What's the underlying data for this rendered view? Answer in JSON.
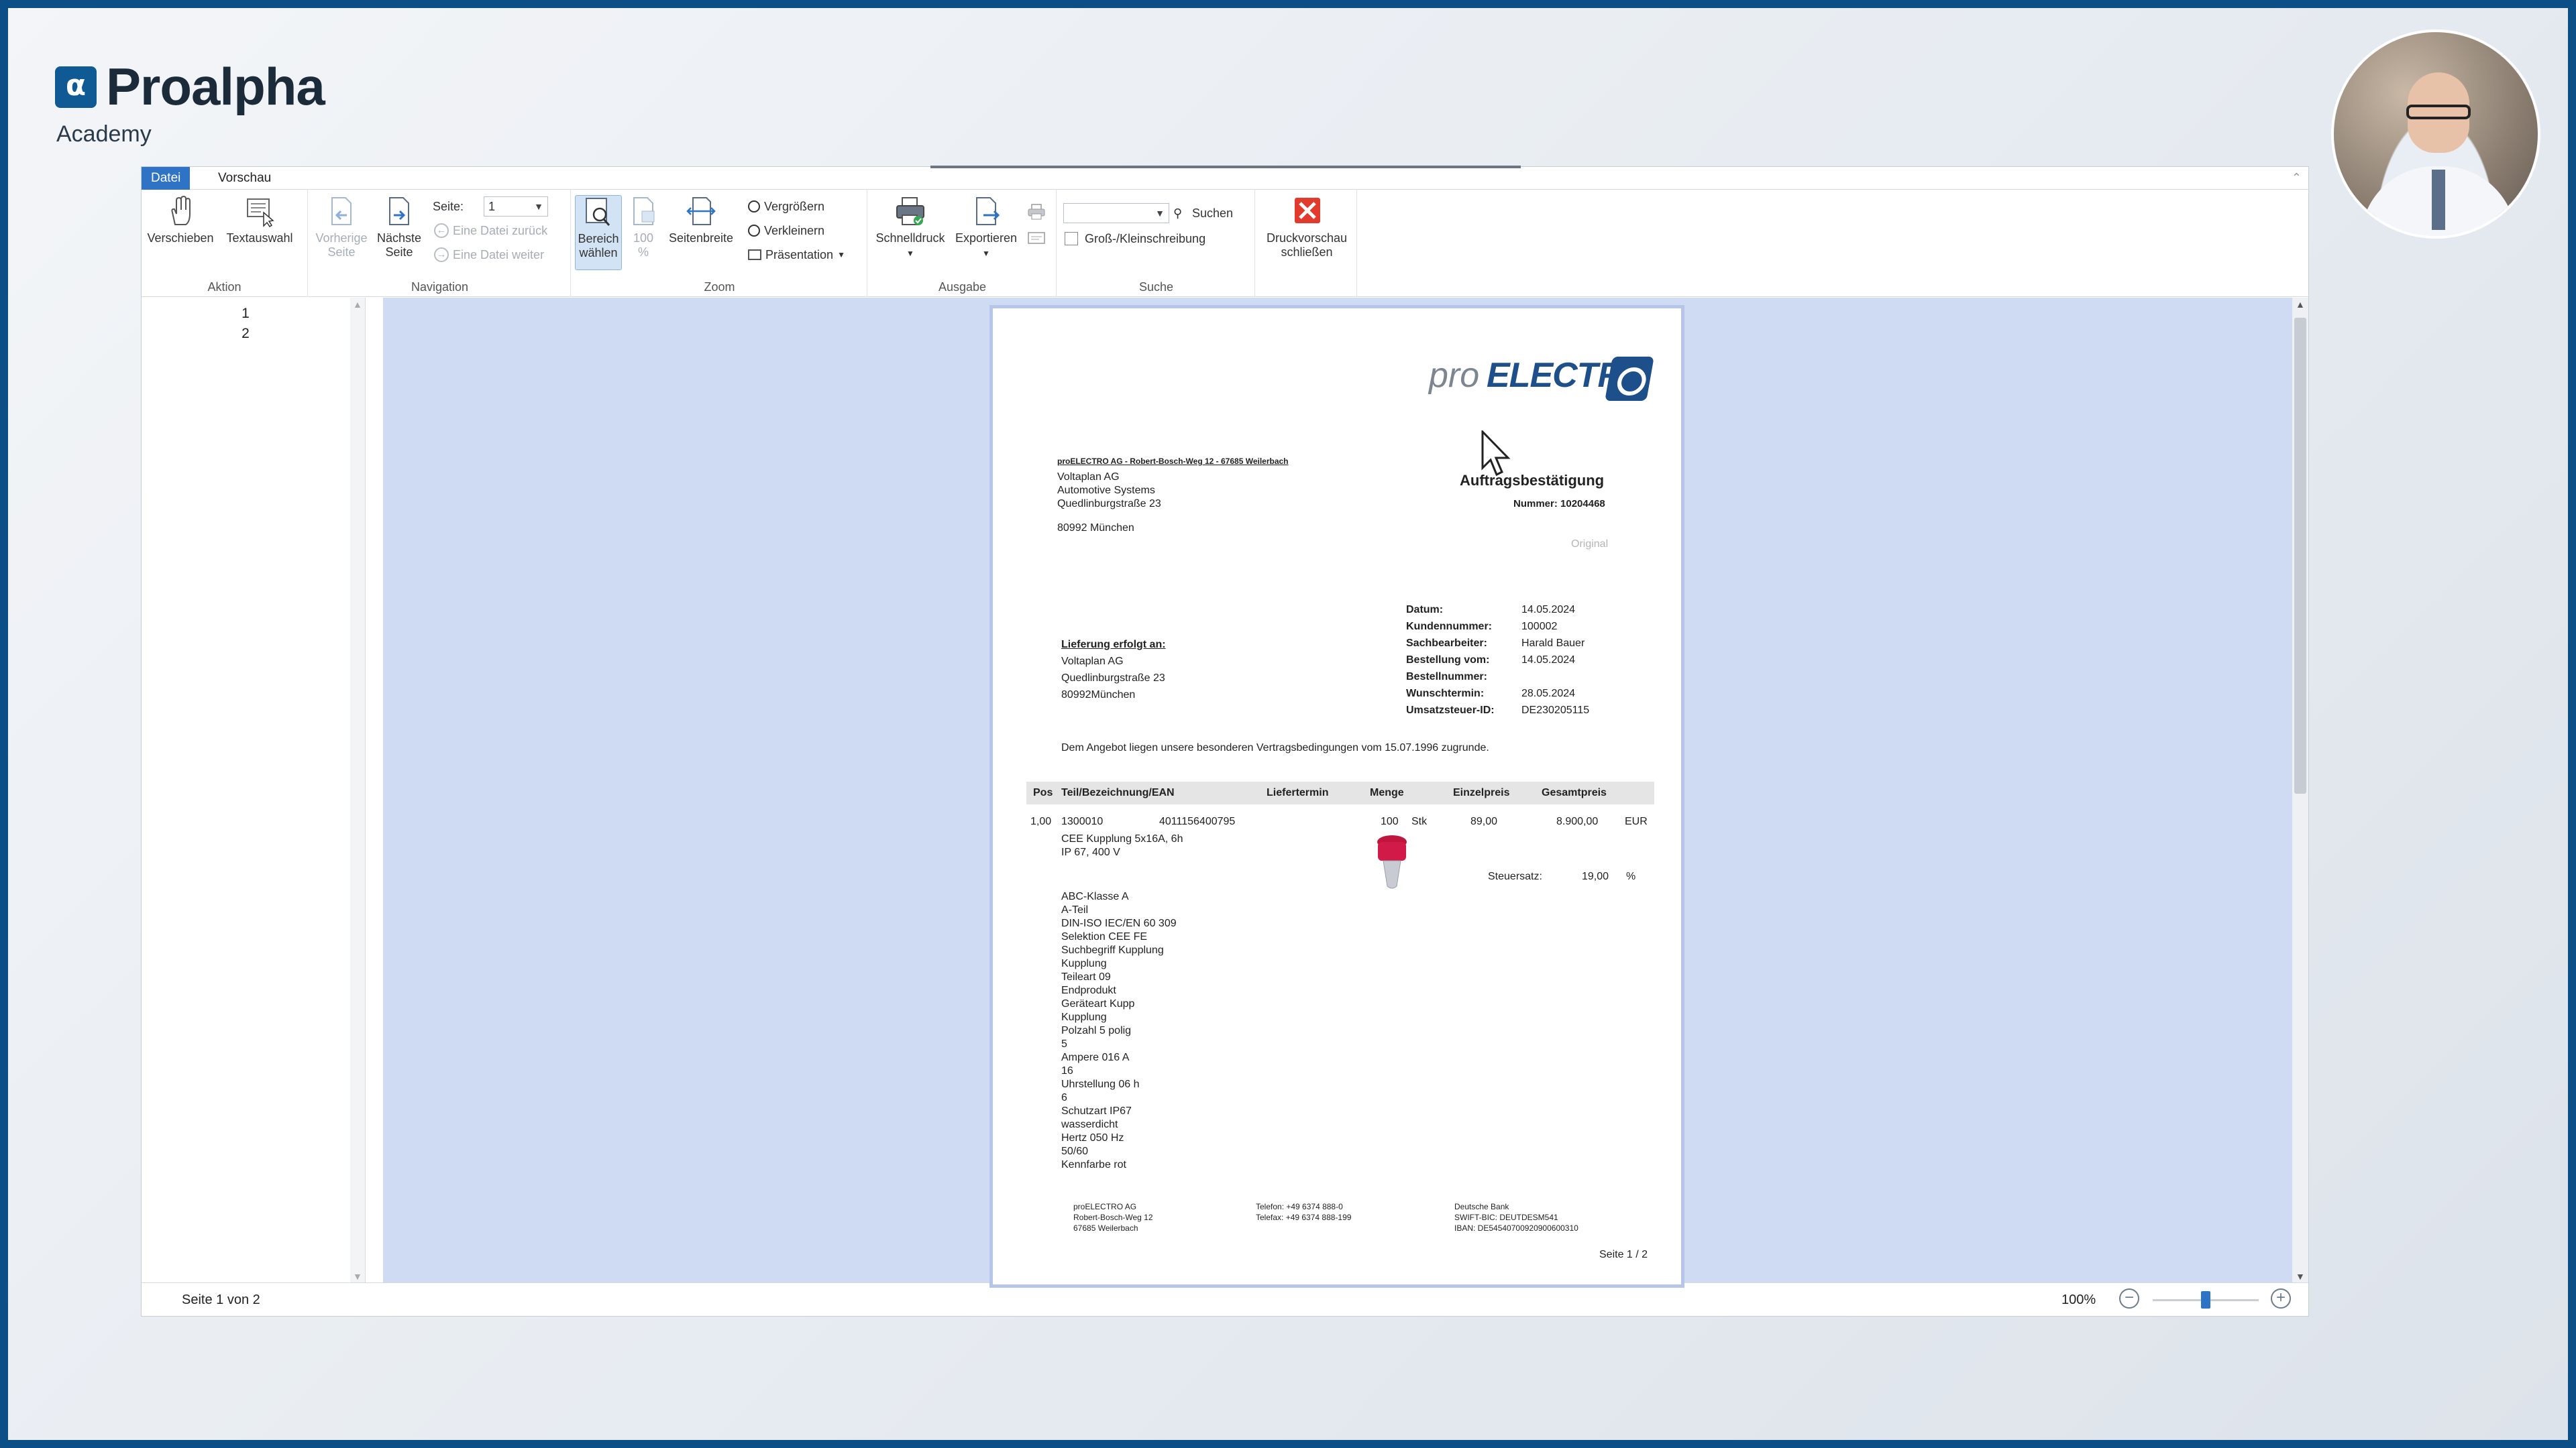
{
  "brand": {
    "name": "Proalpha",
    "sub": "Academy",
    "mark": "α"
  },
  "tabs": [
    {
      "label": "Datei",
      "active": true
    },
    {
      "label": "Vorschau",
      "active": false
    }
  ],
  "ribbon": {
    "aktion": {
      "label": "Aktion",
      "verschieben": "Verschieben",
      "textauswahl": "Textauswahl"
    },
    "navigation": {
      "label": "Navigation",
      "vorherige_1": "Vorherige",
      "vorherige_2": "Seite",
      "naechste_1": "Nächste",
      "naechste_2": "Seite",
      "seite_label": "Seite:",
      "seite_value": "1",
      "datei_zurueck": "Eine Datei zurück",
      "datei_weiter": "Eine Datei weiter"
    },
    "zoom": {
      "label": "Zoom",
      "bereich_1": "Bereich",
      "bereich_2": "wählen",
      "hundert_1": "100",
      "hundert_2": "%",
      "seitenbreite": "Seitenbreite",
      "vergroessern": "Vergrößern",
      "verkleinern": "Verkleinern",
      "praesentation": "Präsentation"
    },
    "ausgabe": {
      "label": "Ausgabe",
      "schnelldruck": "Schnelldruck",
      "exportieren": "Exportieren"
    },
    "suche": {
      "label": "Suche",
      "suchen": "Suchen",
      "grossklein": "Groß-/Kleinschreibung"
    },
    "schliessen": {
      "line1": "Druckvorschau",
      "line2": "schließen"
    }
  },
  "thumbs": [
    "1",
    "2"
  ],
  "status": {
    "page": "Seite 1 von 2",
    "zoom": "100%",
    "zoom_fraction": 0.5
  },
  "doc": {
    "logo_pro": "pro",
    "logo_elec": "ELECTR",
    "sender_line": "proELECTRO AG - Robert-Bosch-Weg 12 - 67685 Weilerbach",
    "recipient": [
      "Voltaplan AG",
      "Automotive Systems",
      "Quedlinburgstraße 23",
      "",
      "80992 München"
    ],
    "title": "Auftragsbestätigung",
    "nummer": "Nummer: 10204468",
    "original": "Original",
    "meta": [
      {
        "k": "Datum:",
        "v": "14.05.2024"
      },
      {
        "k": "Kundennummer:",
        "v": "100002"
      },
      {
        "k": "Sachbearbeiter:",
        "v": "Harald Bauer"
      },
      {
        "k": "Bestellung vom:",
        "v": "14.05.2024"
      },
      {
        "k": "Bestellnummer:",
        "v": ""
      },
      {
        "k": "Wunschtermin:",
        "v": "28.05.2024"
      },
      {
        "k": "Umsatzsteuer-ID:",
        "v": "DE230205115"
      }
    ],
    "delivery_heading": "Lieferung erfolgt an:",
    "delivery": [
      "Voltaplan AG",
      "Quedlinburgstraße 23",
      "80992München"
    ],
    "agreement": "Dem Angebot liegen unsere besonderen Vertragsbedingungen vom 15.07.1996 zugrunde.",
    "columns": {
      "pos": "Pos",
      "teil": "Teil/Bezeichnung/EAN",
      "liefer": "Liefertermin",
      "menge": "Menge",
      "einzel": "Einzelpreis",
      "gesamt": "Gesamtpreis"
    },
    "row": {
      "pos": "1,00",
      "teil": "1300010",
      "ean": "4011156400795",
      "menge": "100",
      "unit": "Stk",
      "einzel": "89,00",
      "gesamt": "8.900,00",
      "currency": "EUR",
      "desc1": "CEE Kupplung 5x16A, 6h",
      "desc2": "IP 67, 400 V",
      "steuer_label": "Steuersatz:",
      "steuer_value": "19,00",
      "steuer_unit": "%"
    },
    "attributes": [
      "ABC-Klasse A",
      "A-Teil",
      "DIN-ISO IEC/EN 60 309",
      "Selektion CEE FE",
      "Suchbegriff Kupplung",
      "Kupplung",
      "Teileart 09",
      "Endprodukt",
      "Geräteart Kupp",
      "Kupplung",
      "Polzahl 5 polig",
      "5",
      "Ampere 016 A",
      "16",
      "Uhrstellung 06 h",
      "6",
      "Schutzart IP67",
      "wasserdicht",
      "Hertz 050 Hz",
      "50/60",
      "Kennfarbe rot"
    ],
    "footer": {
      "col1": [
        "proELECTRO AG",
        "Robert-Bosch-Weg 12",
        "67685 Weilerbach"
      ],
      "col2": [
        "Telefon: +49 6374 888-0",
        "Telefax: +49 6374 888-199"
      ],
      "col3": [
        "Deutsche Bank",
        "SWIFT-BIC: DEUTDESM541",
        "IBAN: DE54540700920900600310"
      ]
    },
    "pageno": "Seite 1 / 2"
  }
}
